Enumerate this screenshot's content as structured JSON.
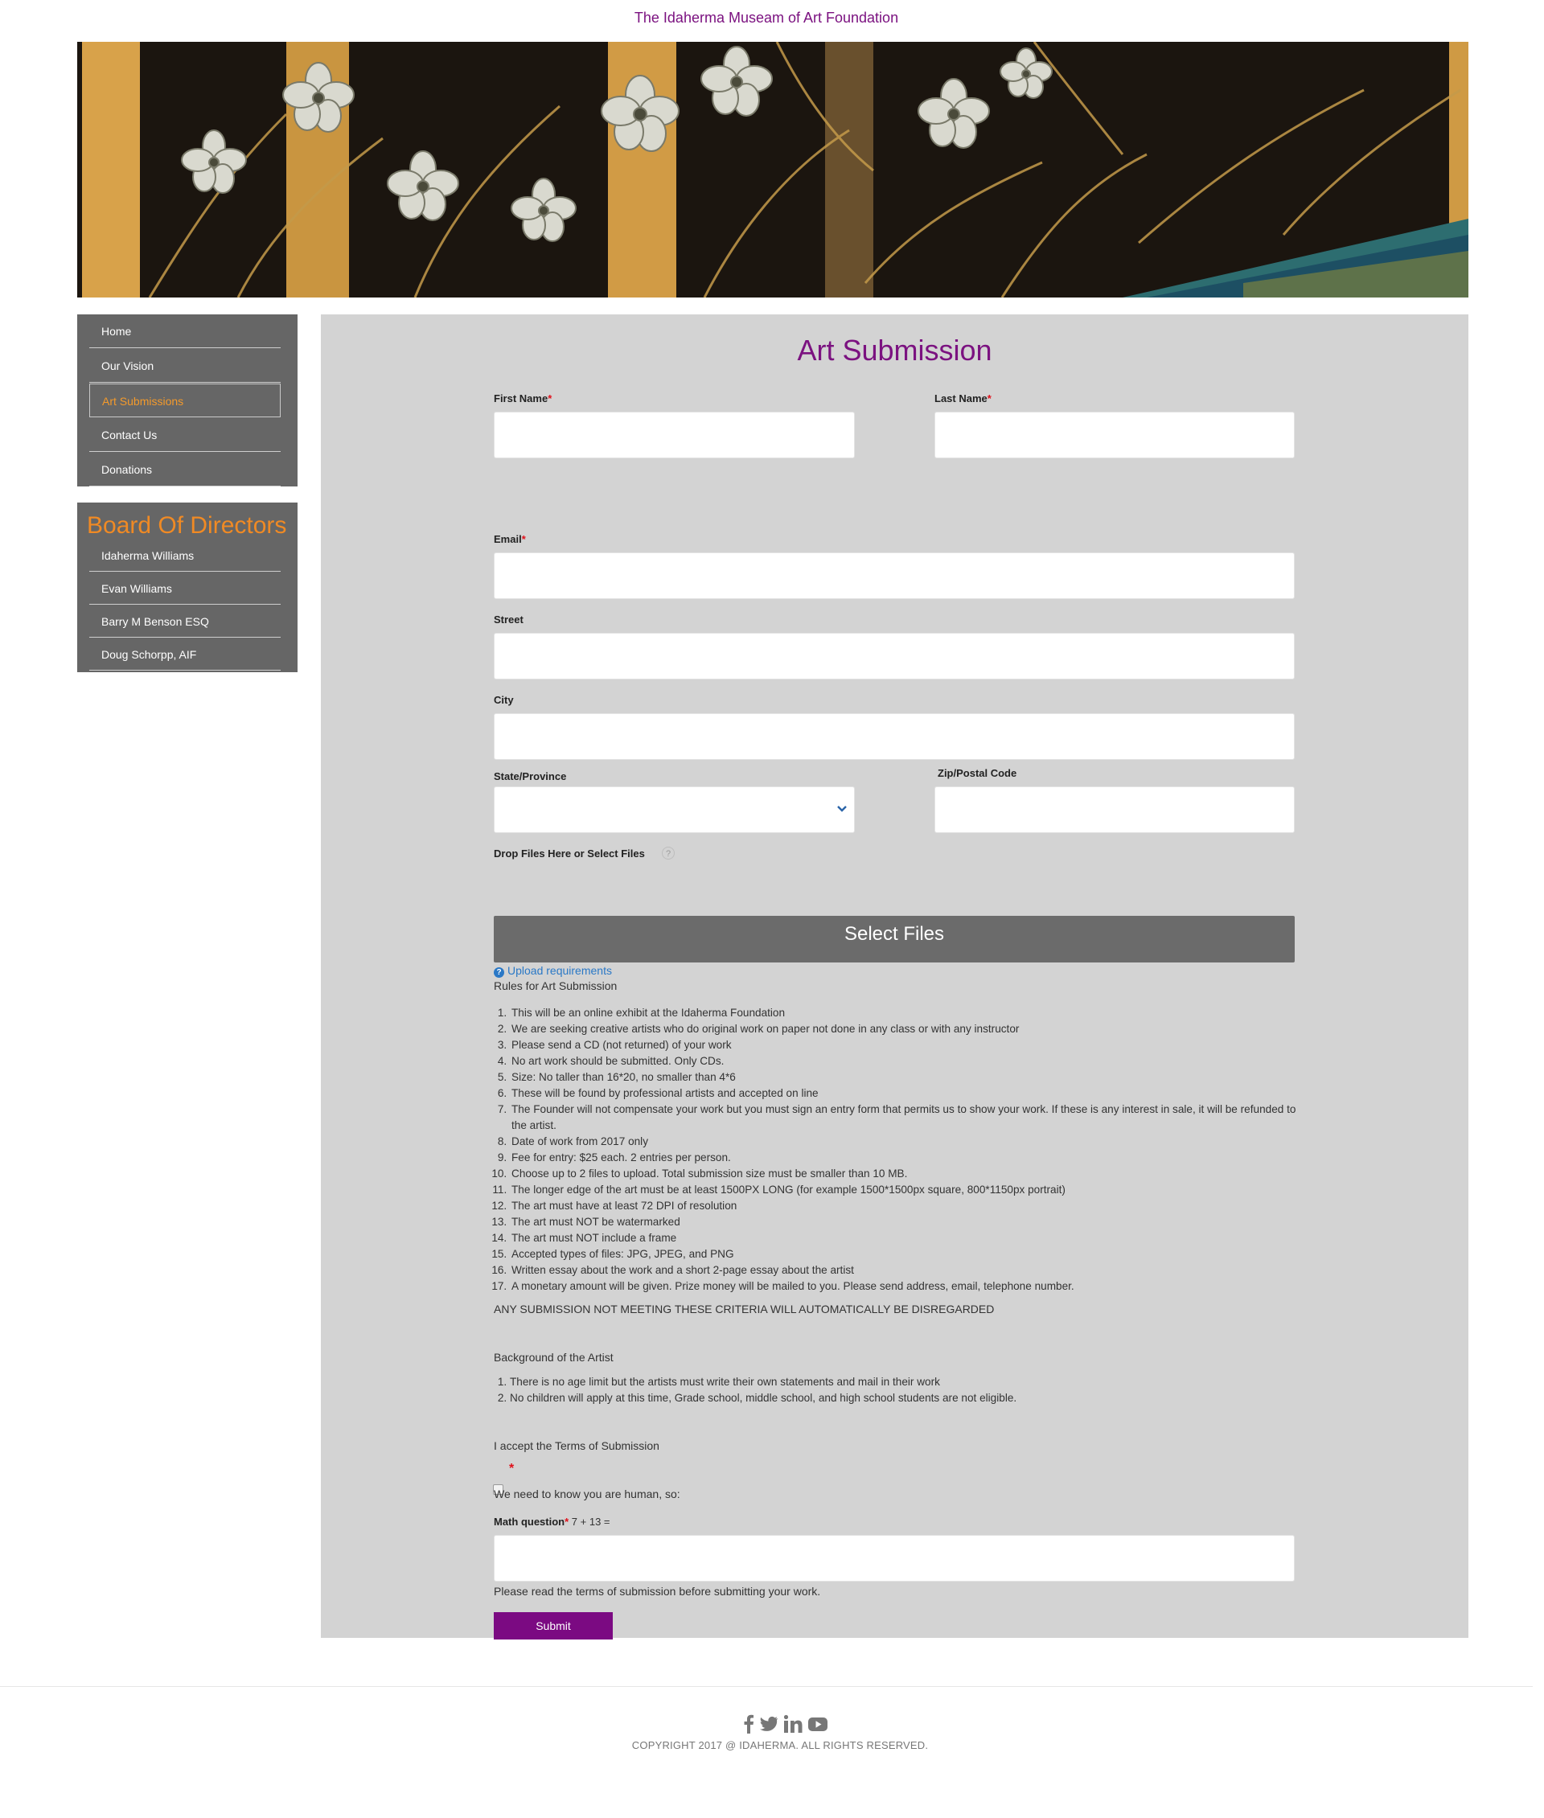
{
  "site": {
    "title": "The Idaherma Museam of Art Foundation"
  },
  "nav": {
    "items": [
      {
        "label": "Home"
      },
      {
        "label": "Our Vision"
      },
      {
        "label": "Art Submissions"
      },
      {
        "label": "Contact Us"
      },
      {
        "label": "Donations"
      }
    ],
    "active_label": "Art Submissions"
  },
  "board": {
    "title": "Board Of Directors",
    "members": [
      {
        "label": "Idaherma Williams"
      },
      {
        "label": "Evan Williams"
      },
      {
        "label": "Barry M Benson ESQ"
      },
      {
        "label": "Doug Schorpp, AIF"
      }
    ]
  },
  "form": {
    "title": "Art Submission",
    "first_name_label": "First Name",
    "last_name_label": "Last Name",
    "email_label": "Email",
    "street_label": "Street",
    "city_label": "City",
    "state_label": "State/Province",
    "zip_label": "Zip/Postal Code",
    "required_mark": "*",
    "first_name_value": "",
    "last_name_value": "",
    "email_value": "",
    "street_value": "",
    "city_value": "",
    "state_value": "",
    "zip_value": "",
    "drop_files_label": "Drop Files Here or Select Files",
    "help_glyph": "?",
    "select_files_label": "Select Files",
    "upload_requirements_link": "Upload requirements",
    "rules_heading": "Rules for Art Submission",
    "rules": [
      "This will be an online exhibit at the Idaherma Foundation",
      "We are seeking creative artists who do original work on paper not done in any class or with any instructor",
      "Please send a CD (not returned) of your work",
      "No art work should be submitted. Only CDs.",
      "Size: No taller than 16*20, no smaller than 4*6",
      "These will be found by professional artists and accepted on line",
      "The Founder will not compensate your work but you must sign an entry form that permits us to show your work. If these is any interest in sale, it will be refunded to the artist.",
      "Date of work from 2017 only",
      "Fee for entry: $25 each. 2 entries per person.",
      "Choose up to 2 files to upload. Total submission size must be smaller than 10 MB.",
      "The longer edge of the art must be at least 1500PX LONG (for example 1500*1500px square, 800*1150px portrait)",
      "The art must have at least 72 DPI of resolution",
      "The art must NOT be watermarked",
      "The art must NOT include a frame",
      "Accepted types of files: JPG, JPEG, and PNG",
      "Written essay about the work and a short 2-page essay about the artist",
      "A monetary amount will be given. Prize money will be mailed to you. Please send address, email, telephone number."
    ],
    "criteria_notice": "ANY SUBMISSION NOT MEETING THESE CRITERIA WILL AUTOMATICALLY BE DISREGARDED",
    "background_heading": "Background of the Artist",
    "background_items": [
      "There is no age limit but the artists must write their own statements and mail in their work",
      "No children will apply at this time, Grade school, middle school, and high school students are not eligible."
    ],
    "terms_label": "I accept the Terms of Submission",
    "human_text": "We need to know you are human, so:",
    "math_label": "Math question",
    "math_expression": "7 + 13 =",
    "math_value": "",
    "read_terms_note": "Please read the terms of submission before submitting your work.",
    "submit_label": "Submit"
  },
  "footer": {
    "social_icons": [
      "facebook-icon",
      "twitter-icon",
      "linkedin-icon",
      "youtube-icon"
    ],
    "copyright": "COPYRIGHT 2017 @ IDAHERMA. ALL RIGHTS RESERVED."
  },
  "colors": {
    "brand_purple": "#7b1280",
    "accent_orange": "#f08a24",
    "sidebar_gray": "#666666",
    "panel_gray": "#d3d3d3",
    "submit_purple": "#7b0a82",
    "link_blue": "#2a78c6"
  }
}
